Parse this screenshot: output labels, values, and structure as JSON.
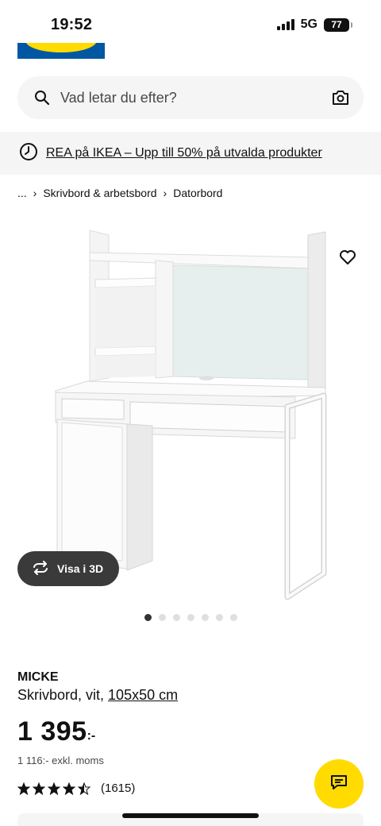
{
  "status_bar": {
    "time": "19:52",
    "network": "5G",
    "battery": "77"
  },
  "search": {
    "placeholder": "Vad letar du efter?"
  },
  "promo": {
    "text": "REA på IKEA – Upp till 50% på utvalda produkter"
  },
  "breadcrumb": {
    "ellipsis": "...",
    "items": [
      "Skrivbord & arbetsbord",
      "Datorbord"
    ]
  },
  "product": {
    "view_3d_label": "Visa i 3D",
    "image_count": 7,
    "active_image": 1,
    "name": "MICKE",
    "description": "Skrivbord, vit,",
    "size": "105x50 cm",
    "price": "1 395",
    "price_suffix": ":-",
    "price_excl": "1 116:- exkl. moms",
    "rating": 4.5,
    "review_count": "(1615)"
  },
  "colors": {
    "ikea_blue": "#0058a3",
    "ikea_yellow": "#ffdb00"
  },
  "icons": [
    "search-icon",
    "camera-icon",
    "clock-icon",
    "heart-icon",
    "rotate-icon",
    "star-icon",
    "chat-icon"
  ]
}
